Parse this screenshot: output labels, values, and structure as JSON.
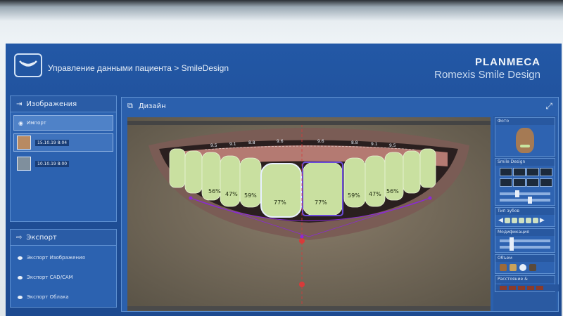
{
  "app": {
    "breadcrumb": "Управление данными пациента > SmileDesign",
    "brand_line1": "PLANMECA",
    "brand_line2": "Romexis Smile Design"
  },
  "left_panel": {
    "images_header": "Изображения",
    "import_label": "Импорт",
    "thumbnails": [
      {
        "label": "15.10.19 8:04"
      },
      {
        "label": "10.10.19 8:00"
      }
    ]
  },
  "export_panel": {
    "header": "Экспорт",
    "items": [
      "Экспорт Изображения",
      "Экспорт CAD/CAM",
      "Экспорт Облака"
    ]
  },
  "design_panel": {
    "title": "Дизайн",
    "tooth_percentages": [
      "56%",
      "47%",
      "59%",
      "77%",
      "77%",
      "59%",
      "47%",
      "56%"
    ],
    "ratio_labels": [
      "9.5",
      "9.1",
      "8.8",
      "9.6",
      "9.6",
      "8.8",
      "9.1",
      "9.5"
    ]
  },
  "right_side": {
    "patient_title": "Фото",
    "smile_design_title": "Smile Design",
    "section3_title": "Тип зубов",
    "section4_title": "Модификация",
    "section5_title": "Объем",
    "section6_title": "Расстояние & Инструменты"
  },
  "colors": {
    "screen_blue": "#2358a6",
    "accent_guide": "#8b2ad8",
    "red_guide": "#d83a3a"
  }
}
